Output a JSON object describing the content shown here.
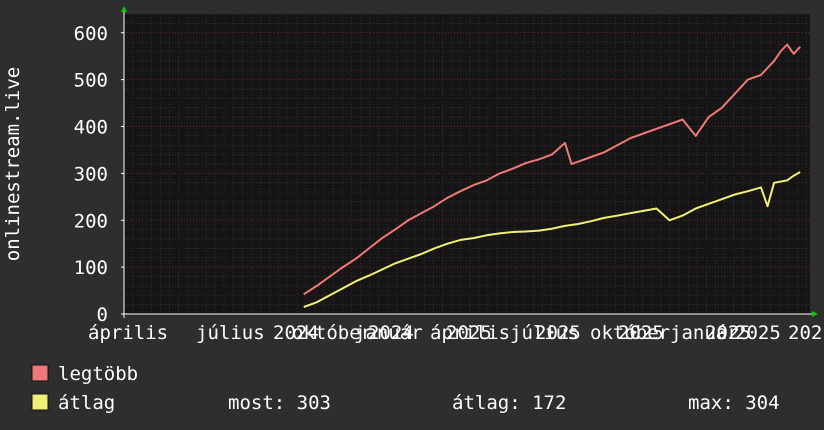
{
  "colors": {
    "background": "#2e2e2e",
    "plot_background": "#151515",
    "grid_minor": "#3a2a2a",
    "grid_major": "#6a2a2a",
    "axis": "#ffffff",
    "arrow": "#00cc00"
  },
  "chart_data": {
    "type": "line",
    "ylabel": "onlinestream.live",
    "ylim": [
      0,
      640
    ],
    "yticks": [
      0,
      100,
      200,
      300,
      400,
      500,
      600
    ],
    "x_tick_labels": [
      "április",
      "július",
      "2024",
      "október",
      "január",
      "2024",
      "április",
      "2025",
      "július",
      "2025",
      "október",
      "2025",
      "január",
      "2025",
      "2025",
      "202"
    ],
    "x_tick_positions": [
      0.5,
      1.5,
      2.5,
      3.5,
      4.5,
      5.5,
      6.5,
      7.5,
      8.5,
      9.5,
      10.5,
      11.5,
      12.5,
      13.5,
      14.5,
      15.5
    ],
    "series": [
      {
        "name": "legtöbb",
        "color": "#f07878",
        "x": [
          0,
          0.4,
          0.8,
          1.2,
          1.6,
          2.0,
          2.4,
          2.8,
          3.2,
          3.6,
          4.0,
          4.4,
          4.8,
          5.2,
          5.6,
          6.0,
          6.4,
          6.8,
          7.2,
          7.6,
          8.0,
          8.2,
          8.4,
          8.8,
          9.2,
          9.6,
          10.0,
          10.4,
          10.8,
          11.2,
          11.6,
          12.0,
          12.4,
          12.8,
          13.2,
          13.6,
          14.0,
          14.4,
          14.6,
          14.8,
          15.0,
          15.2
        ],
        "values": [
          42,
          60,
          80,
          100,
          118,
          140,
          162,
          180,
          200,
          215,
          230,
          248,
          262,
          275,
          285,
          300,
          310,
          322,
          330,
          340,
          365,
          320,
          325,
          335,
          345,
          360,
          375,
          385,
          395,
          405,
          415,
          380,
          420,
          440,
          470,
          500,
          510,
          540,
          560,
          575,
          555,
          570
        ]
      },
      {
        "name": "átlag",
        "color": "#f0f078",
        "x": [
          0,
          0.4,
          0.8,
          1.2,
          1.6,
          2.0,
          2.4,
          2.8,
          3.2,
          3.6,
          4.0,
          4.4,
          4.8,
          5.2,
          5.6,
          6.0,
          6.4,
          6.8,
          7.2,
          7.6,
          8.0,
          8.4,
          8.8,
          9.2,
          9.6,
          10.0,
          10.4,
          10.8,
          11.2,
          11.6,
          12.0,
          12.4,
          12.8,
          13.2,
          13.6,
          14.0,
          14.2,
          14.4,
          14.8,
          15.0,
          15.2
        ],
        "values": [
          15,
          25,
          40,
          55,
          70,
          82,
          95,
          108,
          118,
          128,
          140,
          150,
          158,
          162,
          168,
          172,
          175,
          176,
          178,
          182,
          188,
          192,
          198,
          205,
          210,
          215,
          220,
          225,
          200,
          210,
          225,
          235,
          245,
          255,
          262,
          270,
          230,
          280,
          285,
          295,
          303
        ]
      }
    ],
    "legend": [
      {
        "label": "legtöbb",
        "color": "#f07878"
      },
      {
        "label": "átlag",
        "color": "#f0f078"
      }
    ],
    "stats": {
      "now": "most: 303",
      "avg": "átlag: 172",
      "max": "max: 304"
    }
  }
}
